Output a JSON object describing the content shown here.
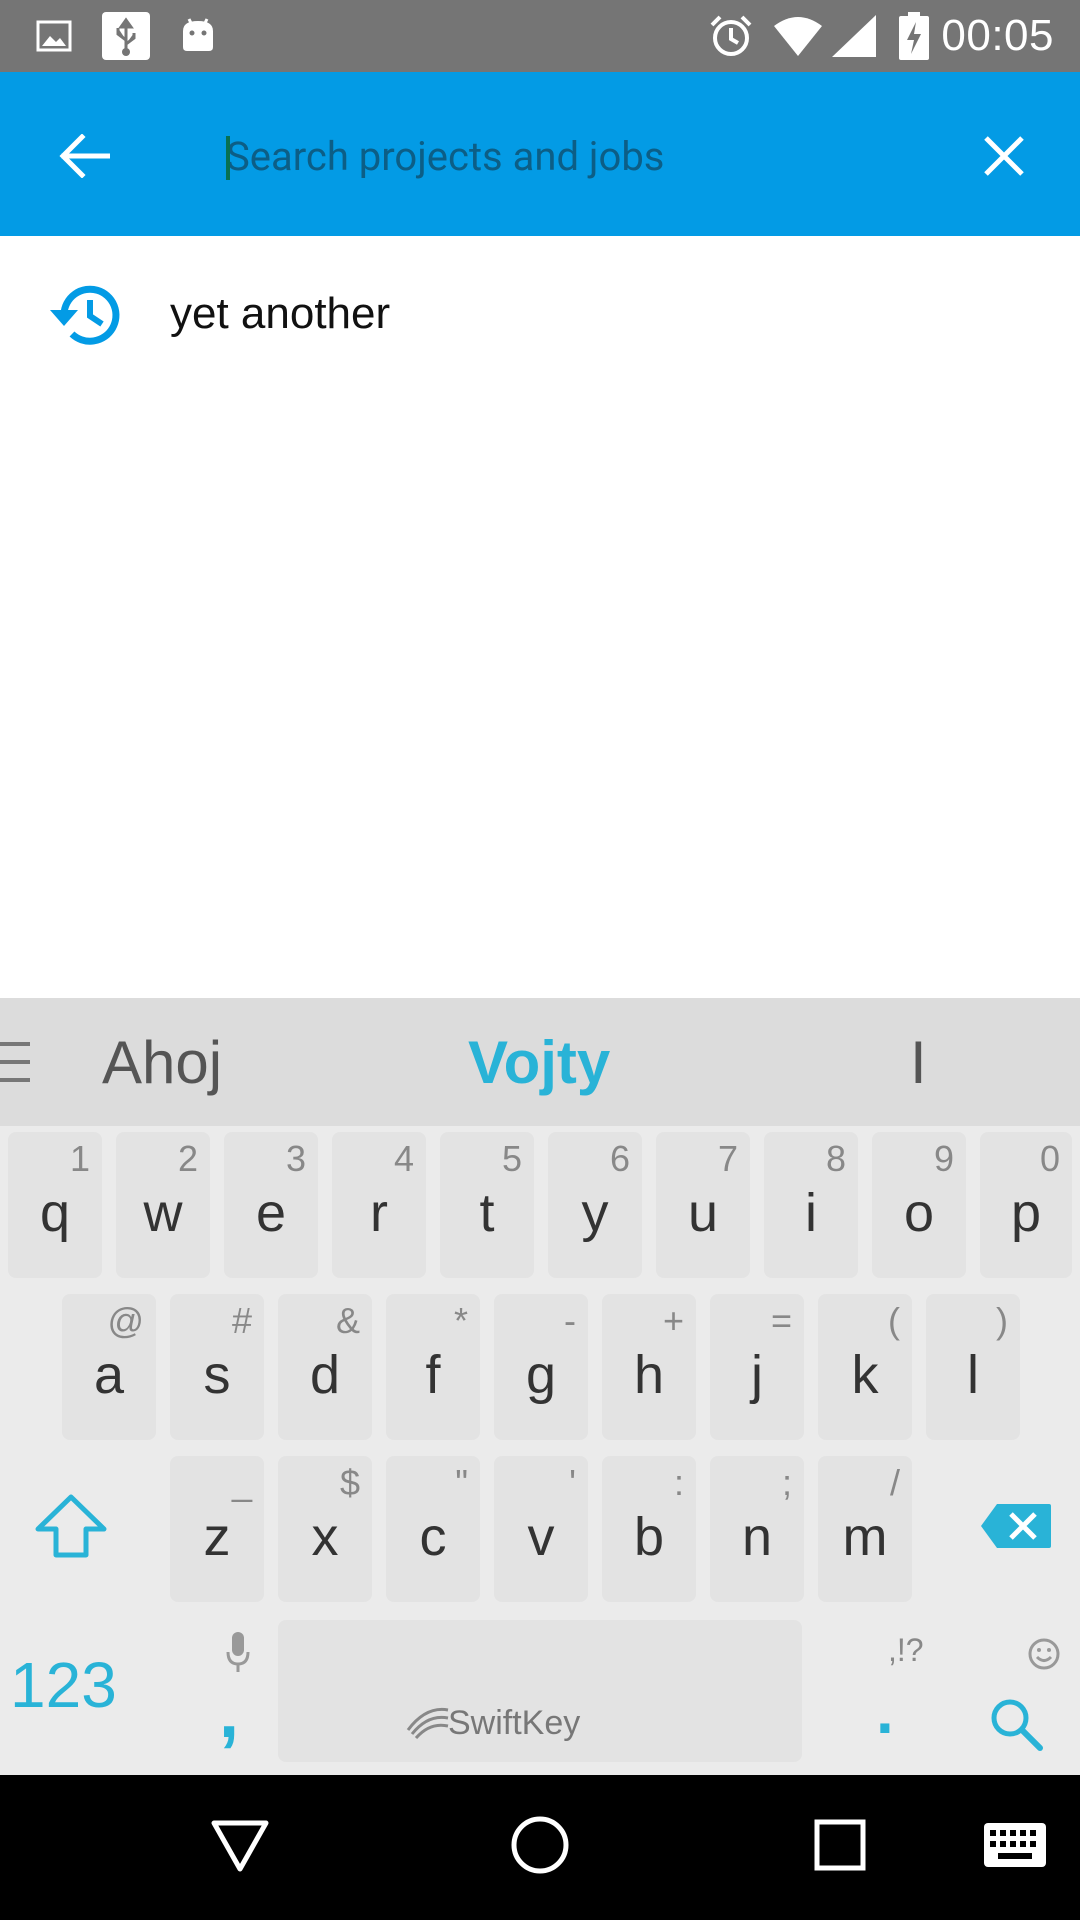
{
  "colors": {
    "status_bar": "#757575",
    "app_bar": "#039be5",
    "accent": "#29b3d7",
    "keyboard_bg": "#ebebeb",
    "nav_bar": "#000000"
  },
  "status_bar": {
    "time": "00:05",
    "left_icons": [
      "image-icon",
      "usb-icon",
      "android-icon"
    ],
    "right_icons": [
      "alarm-icon",
      "wifi-icon",
      "signal-icon",
      "battery-charging-icon"
    ]
  },
  "search": {
    "placeholder": "Search projects and jobs",
    "value": "",
    "back_icon": "arrow-left-icon",
    "clear_icon": "close-icon"
  },
  "suggestions": [
    {
      "icon": "history-icon",
      "text": "yet another"
    }
  ],
  "keyboard": {
    "predictions": [
      "Ahoj",
      "Vojty",
      "I"
    ],
    "row1": [
      {
        "main": "q",
        "hint": "1"
      },
      {
        "main": "w",
        "hint": "2"
      },
      {
        "main": "e",
        "hint": "3"
      },
      {
        "main": "r",
        "hint": "4"
      },
      {
        "main": "t",
        "hint": "5"
      },
      {
        "main": "y",
        "hint": "6"
      },
      {
        "main": "u",
        "hint": "7"
      },
      {
        "main": "i",
        "hint": "8"
      },
      {
        "main": "o",
        "hint": "9"
      },
      {
        "main": "p",
        "hint": "0"
      }
    ],
    "row2": [
      {
        "main": "a",
        "hint": "@"
      },
      {
        "main": "s",
        "hint": "#"
      },
      {
        "main": "d",
        "hint": "&"
      },
      {
        "main": "f",
        "hint": "*"
      },
      {
        "main": "g",
        "hint": "-"
      },
      {
        "main": "h",
        "hint": "+"
      },
      {
        "main": "j",
        "hint": "="
      },
      {
        "main": "k",
        "hint": "("
      },
      {
        "main": "l",
        "hint": ")"
      }
    ],
    "row3": [
      {
        "main": "z",
        "hint": "_"
      },
      {
        "main": "x",
        "hint": "$"
      },
      {
        "main": "c",
        "hint": "\""
      },
      {
        "main": "v",
        "hint": "'"
      },
      {
        "main": "b",
        "hint": ":"
      },
      {
        "main": "n",
        "hint": ";"
      },
      {
        "main": "m",
        "hint": "/"
      }
    ],
    "numbers_label": "123",
    "comma_label": ",",
    "period_label": ".",
    "period_hint": ",!?",
    "space_brand": "SwiftKey",
    "icons": [
      "shift-icon",
      "backspace-icon",
      "mic-icon",
      "emoji-icon",
      "search-key-icon",
      "menu-icon"
    ]
  },
  "nav_bar": {
    "icons": [
      "back-triangle-icon",
      "home-circle-icon",
      "recents-square-icon",
      "keyboard-switch-icon"
    ]
  }
}
